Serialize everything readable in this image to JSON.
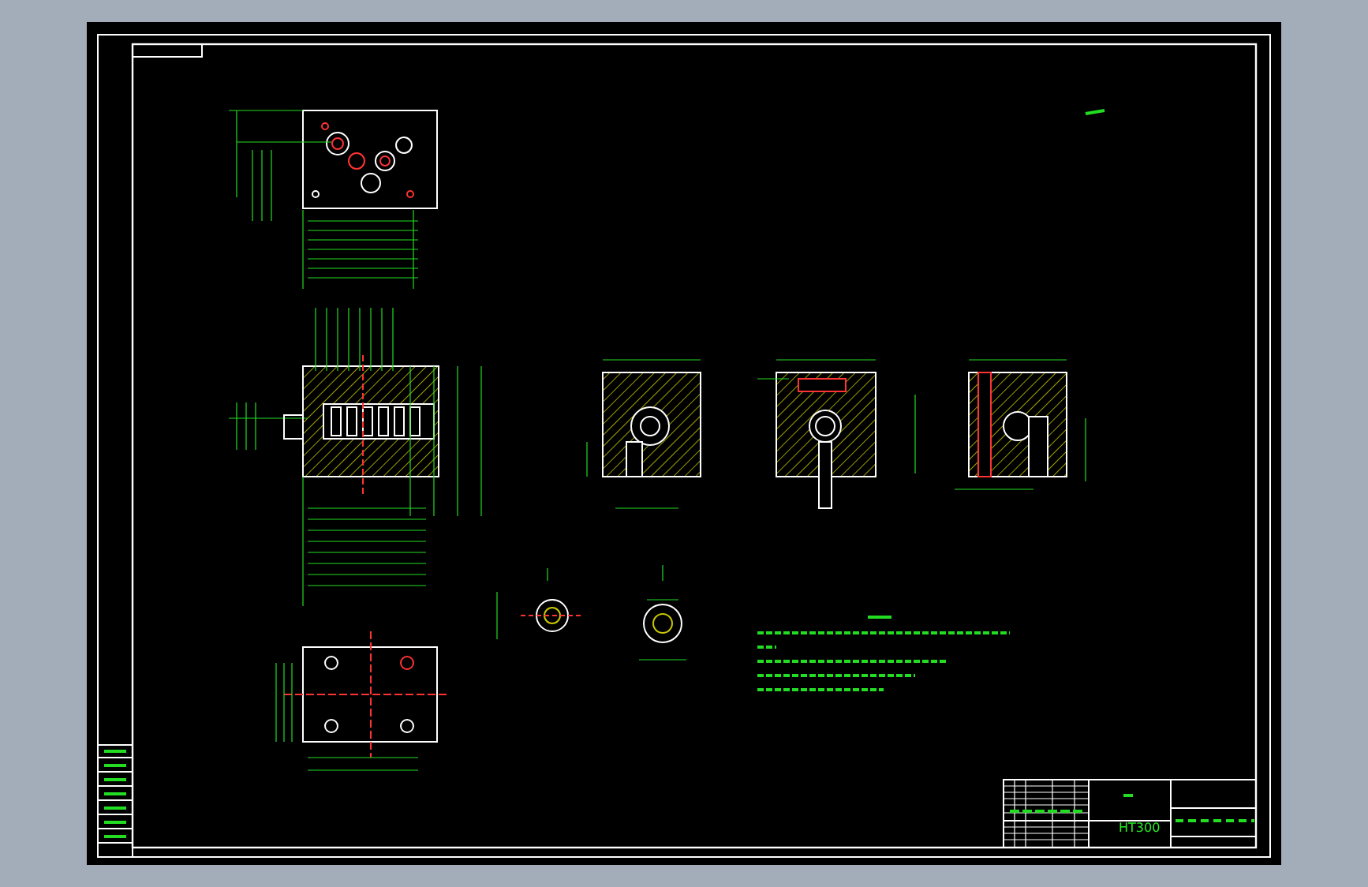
{
  "title_block": {
    "material": "HT300"
  }
}
